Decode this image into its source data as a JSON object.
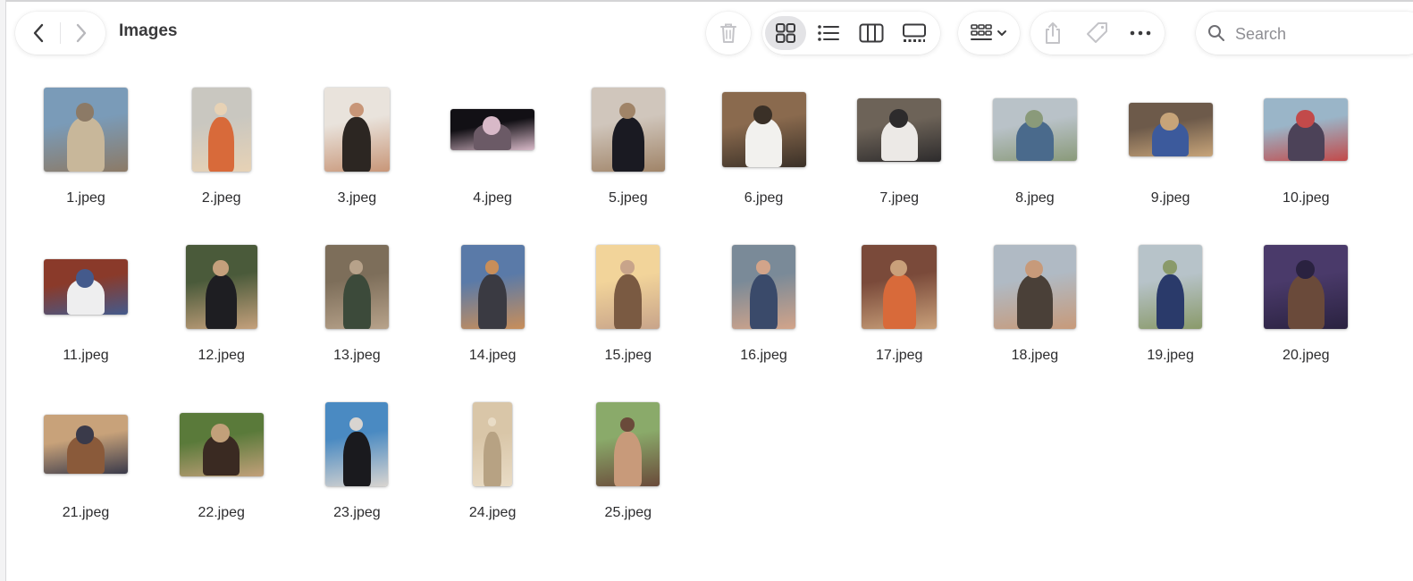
{
  "window": {
    "title": "Images"
  },
  "toolbar": {
    "back_icon": "chevron-left-icon",
    "forward_icon": "chevron-right-icon",
    "delete_icon": "trash-icon",
    "view_modes": [
      "icon-view",
      "list-view",
      "column-view",
      "gallery-view"
    ],
    "selected_view": "icon-view",
    "group_icon": "group-by-icon",
    "share_icon": "share-icon",
    "tag_icon": "tag-icon",
    "more_icon": "ellipsis-icon"
  },
  "search": {
    "placeholder": "Search",
    "value": ""
  },
  "files": [
    {
      "name": "1.jpeg",
      "colors": [
        "#7a9bb8",
        "#c8b79a",
        "#8c7a66"
      ]
    },
    {
      "name": "2.jpeg",
      "colors": [
        "#c9c7c0",
        "#d86a3a",
        "#e7d2b5"
      ]
    },
    {
      "name": "3.jpeg",
      "colors": [
        "#e9e3dc",
        "#2c2622",
        "#c89678"
      ]
    },
    {
      "name": "4.jpeg",
      "colors": [
        "#121015",
        "#6b5a66",
        "#d8b9c8"
      ]
    },
    {
      "name": "5.jpeg",
      "colors": [
        "#d0c6bc",
        "#1a1a22",
        "#a08468"
      ]
    },
    {
      "name": "6.jpeg",
      "colors": [
        "#8a6a4e",
        "#f2f1ee",
        "#3a3027"
      ]
    },
    {
      "name": "7.jpeg",
      "colors": [
        "#6d6358",
        "#ece9e6",
        "#2d2b2c"
      ]
    },
    {
      "name": "8.jpeg",
      "colors": [
        "#b9c2c8",
        "#4a6a8c",
        "#8a9a7a"
      ]
    },
    {
      "name": "9.jpeg",
      "colors": [
        "#6d5a4a",
        "#3c5a9c",
        "#c7a479"
      ]
    },
    {
      "name": "10.jpeg",
      "colors": [
        "#9ab5c8",
        "#4c4258",
        "#c24a4a"
      ]
    },
    {
      "name": "11.jpeg",
      "colors": [
        "#8a3a2a",
        "#eeeeef",
        "#445a8c"
      ]
    },
    {
      "name": "12.jpeg",
      "colors": [
        "#4a5a3a",
        "#1e1e22",
        "#c4a07c"
      ]
    },
    {
      "name": "13.jpeg",
      "colors": [
        "#7d6e5a",
        "#3c4a3a",
        "#b7a28a"
      ]
    },
    {
      "name": "14.jpeg",
      "colors": [
        "#5a7aa8",
        "#3a3a42",
        "#c88e5a"
      ]
    },
    {
      "name": "15.jpeg",
      "colors": [
        "#f2d49a",
        "#7a5a42",
        "#c8a48a"
      ]
    },
    {
      "name": "16.jpeg",
      "colors": [
        "#7a8a98",
        "#3a4a6a",
        "#d2a48a"
      ]
    },
    {
      "name": "17.jpeg",
      "colors": [
        "#7a4a3a",
        "#d86a3a",
        "#c9a07a"
      ]
    },
    {
      "name": "18.jpeg",
      "colors": [
        "#b0bac4",
        "#4a4038",
        "#c79a7a"
      ]
    },
    {
      "name": "19.jpeg",
      "colors": [
        "#b7c3c9",
        "#2a3a6a",
        "#8a9a6a"
      ]
    },
    {
      "name": "20.jpeg",
      "colors": [
        "#4a3a6a",
        "#6a4a3a",
        "#2a2240"
      ]
    },
    {
      "name": "21.jpeg",
      "colors": [
        "#c8a27a",
        "#8a5a3a",
        "#3a3a4a"
      ]
    },
    {
      "name": "22.jpeg",
      "colors": [
        "#5a7a3a",
        "#3a2a22",
        "#c2a07a"
      ]
    },
    {
      "name": "23.jpeg",
      "colors": [
        "#4a8ac2",
        "#1a1a1e",
        "#d8d4d0"
      ]
    },
    {
      "name": "24.jpeg",
      "colors": [
        "#d9c6a8",
        "#b7a283",
        "#e9dcc6"
      ]
    },
    {
      "name": "25.jpeg",
      "colors": [
        "#8aaa6a",
        "#c89a7a",
        "#6a4a3a"
      ]
    }
  ]
}
